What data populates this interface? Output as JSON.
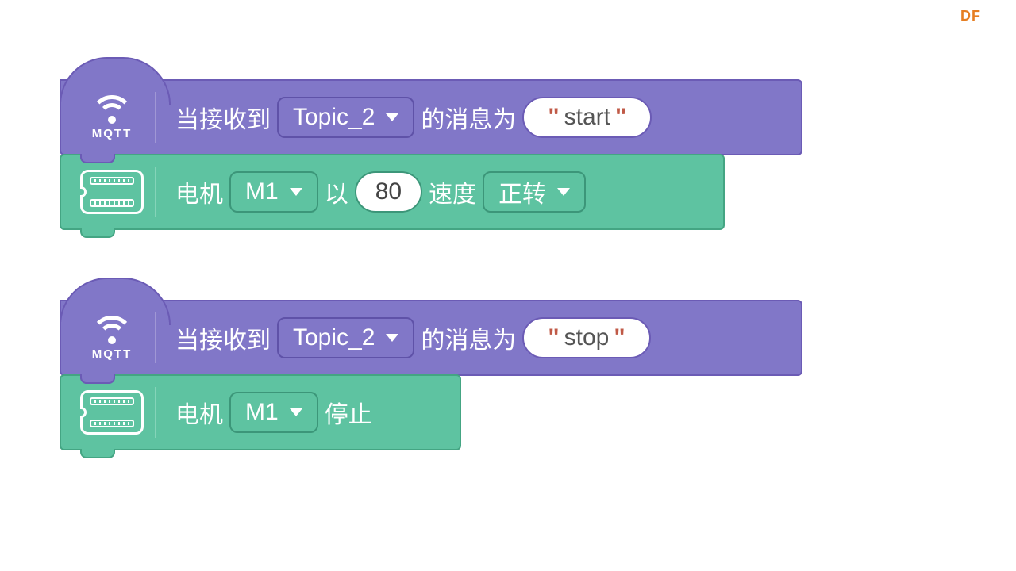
{
  "watermark": "DF",
  "mqtt_label": "MQTT",
  "scripts": [
    {
      "hat": {
        "prefix": "当接收到",
        "topic": "Topic_2",
        "mid": "的消息为",
        "message": "start"
      },
      "body": {
        "label_motor": "电机",
        "motor": "M1",
        "label_at": "以",
        "speed": "80",
        "label_speed": "速度",
        "direction": "正转"
      }
    },
    {
      "hat": {
        "prefix": "当接收到",
        "topic": "Topic_2",
        "mid": "的消息为",
        "message": "stop"
      },
      "body": {
        "label_motor": "电机",
        "motor": "M1",
        "label_stop": "停止"
      }
    }
  ]
}
